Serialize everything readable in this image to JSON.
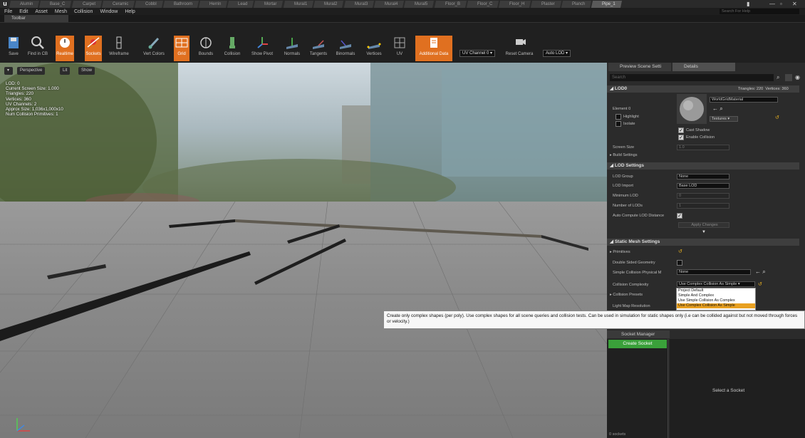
{
  "app": {
    "logo": "u"
  },
  "doc_tabs": [
    "Alumin",
    "Base_C",
    "Carpet",
    "Ceramic",
    "Cobbl",
    "Bathroom",
    "Herrin",
    "Lead",
    "Mortar",
    "Mural1",
    "Mural2",
    "Mural3",
    "Mural4",
    "Mural5",
    "Floor_B",
    "Floor_C",
    "Floor_H",
    "Plaster",
    "Planch",
    "Pipe_1"
  ],
  "menu": [
    "File",
    "Edit",
    "Asset",
    "Mesh",
    "Collision",
    "Window",
    "Help"
  ],
  "help_search_placeholder": "Search For Help",
  "toolbar_tab": "Toolbar",
  "toolbar": {
    "buttons": [
      "Save",
      "Find in CB",
      "Realtime",
      "Sockets",
      "Wireframe",
      "Vert Colors",
      "Grid",
      "Bounds",
      "Collision",
      "Show Pivot",
      "Normals",
      "Tangents",
      "Binormals",
      "Vertices",
      "UV",
      "Additional Data"
    ],
    "uv_channel": "UV Channel 0 ▾",
    "reset_camera": "Reset Camera",
    "auto_lod": "Auto LOD ▾"
  },
  "viewport": {
    "perspective": "Perspective",
    "lit": "Lit",
    "show": "Show",
    "stats": [
      "LOD: 0",
      "Current Screen Size: 1.000",
      "Triangles: 220",
      "Vertices: 360",
      "UV Channels: 2",
      "Approx Size: 1,036x1,000x10",
      "Num Collision Primitives: 1"
    ]
  },
  "panel": {
    "tab_preview": "Preview Scene Setti",
    "tab_details": "Details",
    "search_placeholder": "Search",
    "lod0": {
      "header": "LOD0",
      "triangles": "Triangles: 220",
      "vertices": "Vertices: 360",
      "element": "Element 0",
      "highlight": "Highlight",
      "isolate": "Isolate",
      "material": "WorldGridMaterial",
      "textures": "Textures ▾",
      "cast_shadow": "Cast Shadow",
      "enable_collision": "Enable Collision",
      "screen_size_label": "Screen Size",
      "screen_size_value": "1.0",
      "build_settings": "Build Settings"
    },
    "lod_settings": {
      "header": "LOD Settings",
      "lod_group_label": "LOD Group",
      "lod_group_value": "None",
      "lod_import_label": "LOD Import",
      "lod_import_value": "Base LOD",
      "min_lod_label": "Minimum LOD",
      "min_lod_value": "0",
      "num_lods_label": "Number of LODs",
      "num_lods_value": "1",
      "auto_compute_label": "Auto Compute LOD Distance",
      "apply_changes": "Apply Changes"
    },
    "static_mesh": {
      "header": "Static Mesh Settings",
      "primitives": "Primitives",
      "double_sided": "Double Sided Geometry",
      "phys_mat_label": "Simple Collision Physical M",
      "phys_mat_value": "None",
      "complexity_label": "Collision Complexity",
      "complexity_value": "Use Complex Collision As Simple ▾",
      "complexity_options": [
        "Project Default",
        "Simple And Complex",
        "Use Simple Collision As Complex",
        "Use Complex Collision As Simple"
      ],
      "collision_presets": "Collision Presets",
      "light_map": "Light Map Resolution"
    }
  },
  "tooltip": "Create only complex shapes (per poly). Use complex shapes for all scene queries and collision tests. Can be used in simulation for static shapes only (i.e can be collided against but not moved through forces or velocity.)",
  "socket_manager": {
    "tab": "Socket Manager",
    "create_button": "Create Socket",
    "empty_label": "Select a Socket",
    "count": "0 sockets"
  },
  "colors": {
    "accent": "#e07020",
    "create": "#3aa03a"
  }
}
